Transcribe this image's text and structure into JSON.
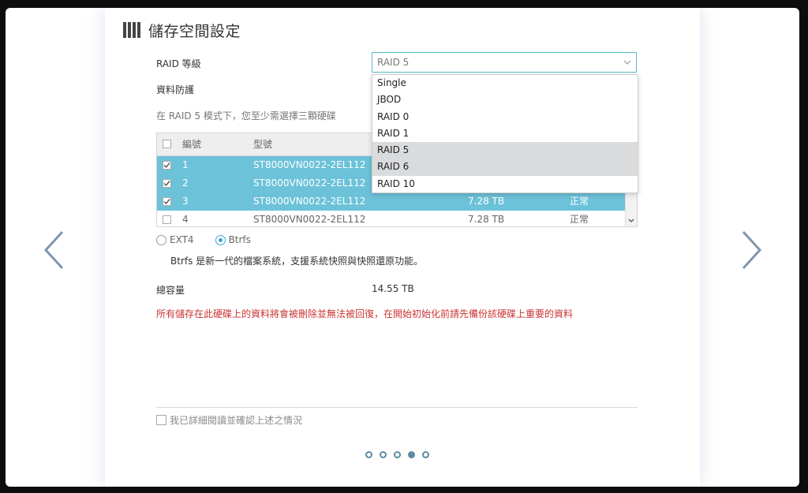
{
  "header": {
    "title": "儲存空間設定",
    "icon": "disk-stack-icon"
  },
  "raid": {
    "label": "RAID 等級",
    "selected": "RAID 5",
    "options": [
      "Single",
      "JBOD",
      "RAID 0",
      "RAID 1",
      "RAID 5",
      "RAID 6",
      "RAID 10"
    ]
  },
  "protection": {
    "label": "資料防護"
  },
  "hint": "在 RAID 5 模式下，您至少需選擇三顆硬碟",
  "table": {
    "headers": {
      "number": "編號",
      "model": "型號"
    },
    "rows": [
      {
        "number": "1",
        "model": "ST8000VN0022-2EL112",
        "size": "",
        "status": "",
        "checked": true
      },
      {
        "number": "2",
        "model": "ST8000VN0022-2EL112",
        "size": "",
        "status": "",
        "checked": true
      },
      {
        "number": "3",
        "model": "ST8000VN0022-2EL112",
        "size": "7.28 TB",
        "status": "正常",
        "checked": true
      },
      {
        "number": "4",
        "model": "ST8000VN0022-2EL112",
        "size": "7.28 TB",
        "status": "正常",
        "checked": false
      }
    ]
  },
  "filesystem": {
    "options": [
      "EXT4",
      "Btrfs"
    ],
    "selected": "Btrfs",
    "description": "Btrfs 是新一代的檔案系統，支援系統快照與快照還原功能。"
  },
  "capacity": {
    "label": "總容量",
    "value": "14.55 TB"
  },
  "warning": "所有儲存在此硬碟上的資料將會被刪除並無法被回復，在開始初始化前請先備份該硬碟上重要的資料",
  "confirm": {
    "label": "我已詳細閱讀並確認上述之情況",
    "checked": false
  },
  "pagination": {
    "total": 5,
    "current": 4
  },
  "colors": {
    "accent": "#5bbbd3",
    "selected_row": "#6cc2d9",
    "warning": "#cc3333",
    "dot": "#5b8ba1"
  }
}
